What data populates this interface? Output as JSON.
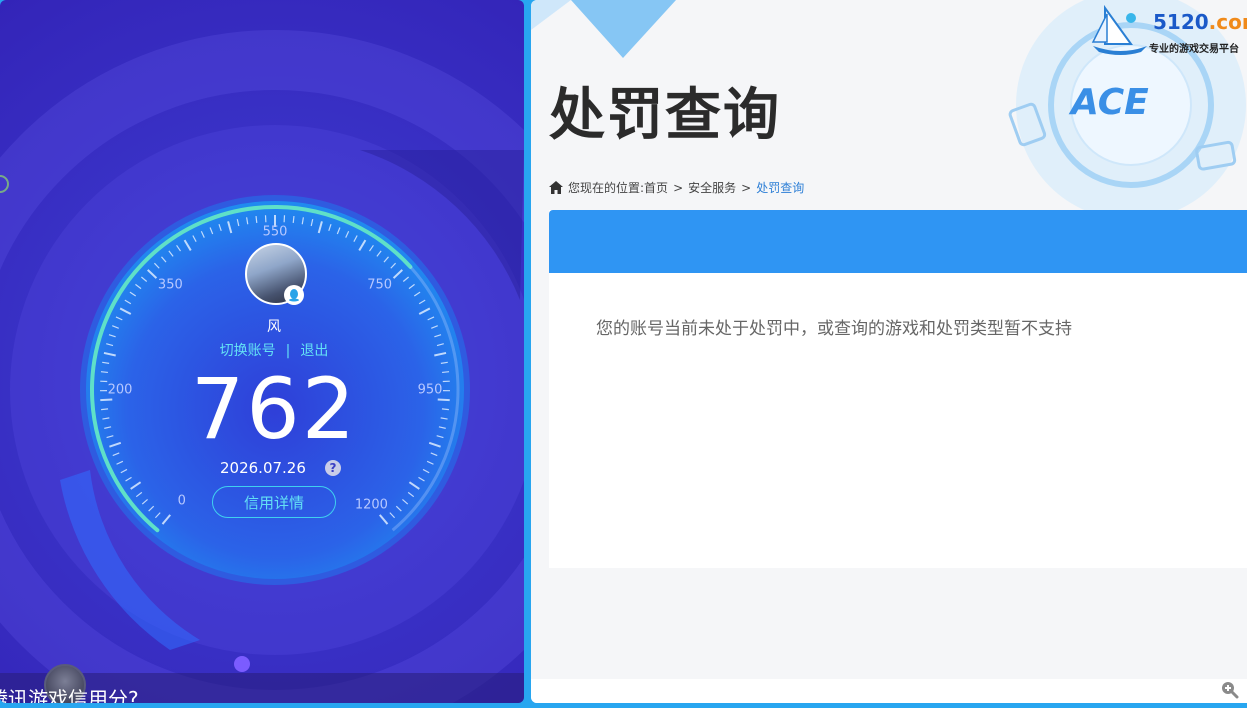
{
  "left": {
    "username": "风",
    "switch_account": "切换账号",
    "separator": "|",
    "logout": "退出",
    "score": "762",
    "date": "2026.07.26",
    "help": "?",
    "credit_detail_button": "信用详情",
    "bottom_text": "腾讯游戏信用分?",
    "gauge_labels": [
      "0",
      "200",
      "350",
      "550",
      "750",
      "950",
      "1200"
    ],
    "gauge_min": 0,
    "gauge_max": 1200,
    "gauge_value": 762,
    "colors": {
      "arc_active": "#5fe0c8",
      "accent": "#63e0f5"
    }
  },
  "right": {
    "title": "处罚查询",
    "breadcrumb": {
      "prefix": "您现在的位置:",
      "items": [
        "首页",
        "安全服务",
        "处罚查询"
      ],
      "separator": ">"
    },
    "message": "您的账号当前未处于处罚中，或查询的游戏和处罚类型暂不支持",
    "logo": {
      "num": "5120",
      "dot": ".com",
      "tagline": "专业的游戏交易平台"
    },
    "ace_logo_text": "ACE",
    "colors": {
      "header_blue": "#2f95f3",
      "link_blue": "#2d7fd6"
    }
  }
}
